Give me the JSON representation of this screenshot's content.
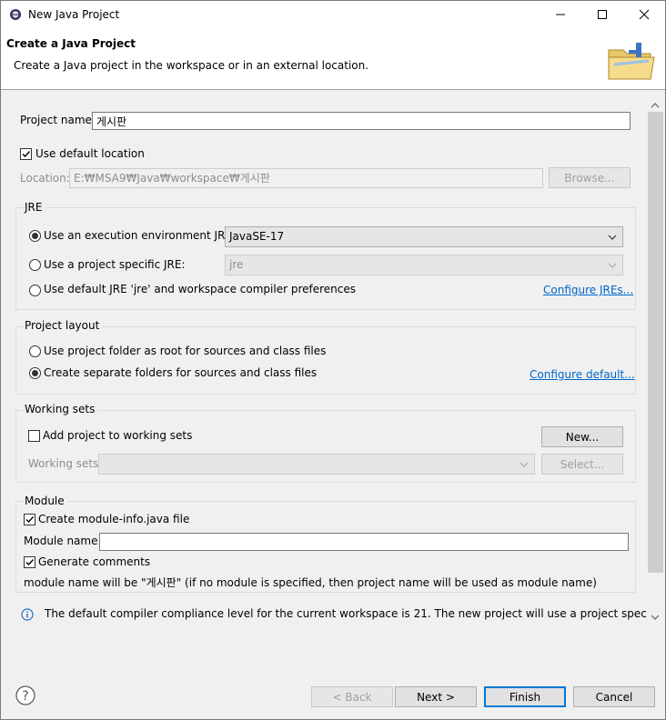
{
  "window": {
    "title": "New Java Project"
  },
  "header": {
    "title": "Create a Java Project",
    "description": "Create a Java project in the workspace or in an external location."
  },
  "project": {
    "name_label": "Project name:",
    "name_value": "게시판",
    "use_default_location_label": "Use default location",
    "use_default_location_checked": true,
    "location_label": "Location:",
    "location_value": "E:₩MSA9₩Java₩workspace₩게시판",
    "browse_label": "Browse..."
  },
  "jre": {
    "group_title": "JRE",
    "option_execution_env": "Use an execution environment JRE:",
    "execution_env_value": "JavaSE-17",
    "option_project_specific": "Use a project specific JRE:",
    "project_specific_value": "jre",
    "option_default": "Use default JRE 'jre' and workspace compiler preferences",
    "configure_link": "Configure JREs...",
    "selected": "execution_env"
  },
  "layout": {
    "group_title": "Project layout",
    "option_root": "Use project folder as root for sources and class files",
    "option_separate": "Create separate folders for sources and class files",
    "configure_link": "Configure default...",
    "selected": "separate"
  },
  "working_sets": {
    "group_title": "Working sets",
    "add_label": "Add project to working sets",
    "add_checked": false,
    "new_button": "New...",
    "sets_label": "Working sets:",
    "select_button": "Select..."
  },
  "module": {
    "group_title": "Module",
    "create_label": "Create module-info.java file",
    "create_checked": true,
    "name_label": "Module name:",
    "name_value": "",
    "generate_comments_label": "Generate comments",
    "generate_comments_checked": true,
    "info_text": "module name will be \"게시판\"  (if no module is specified, then project name will be used as module name)"
  },
  "info": {
    "message": "The default compiler compliance level for the current workspace is 21. The new project will use a project specific"
  },
  "footer": {
    "back_label": "< Back",
    "next_label": "Next >",
    "finish_label": "Finish",
    "cancel_label": "Cancel"
  },
  "colors": {
    "accent": "#0078d7",
    "link": "#0066cc",
    "info_icon": "#1f6fb5"
  }
}
